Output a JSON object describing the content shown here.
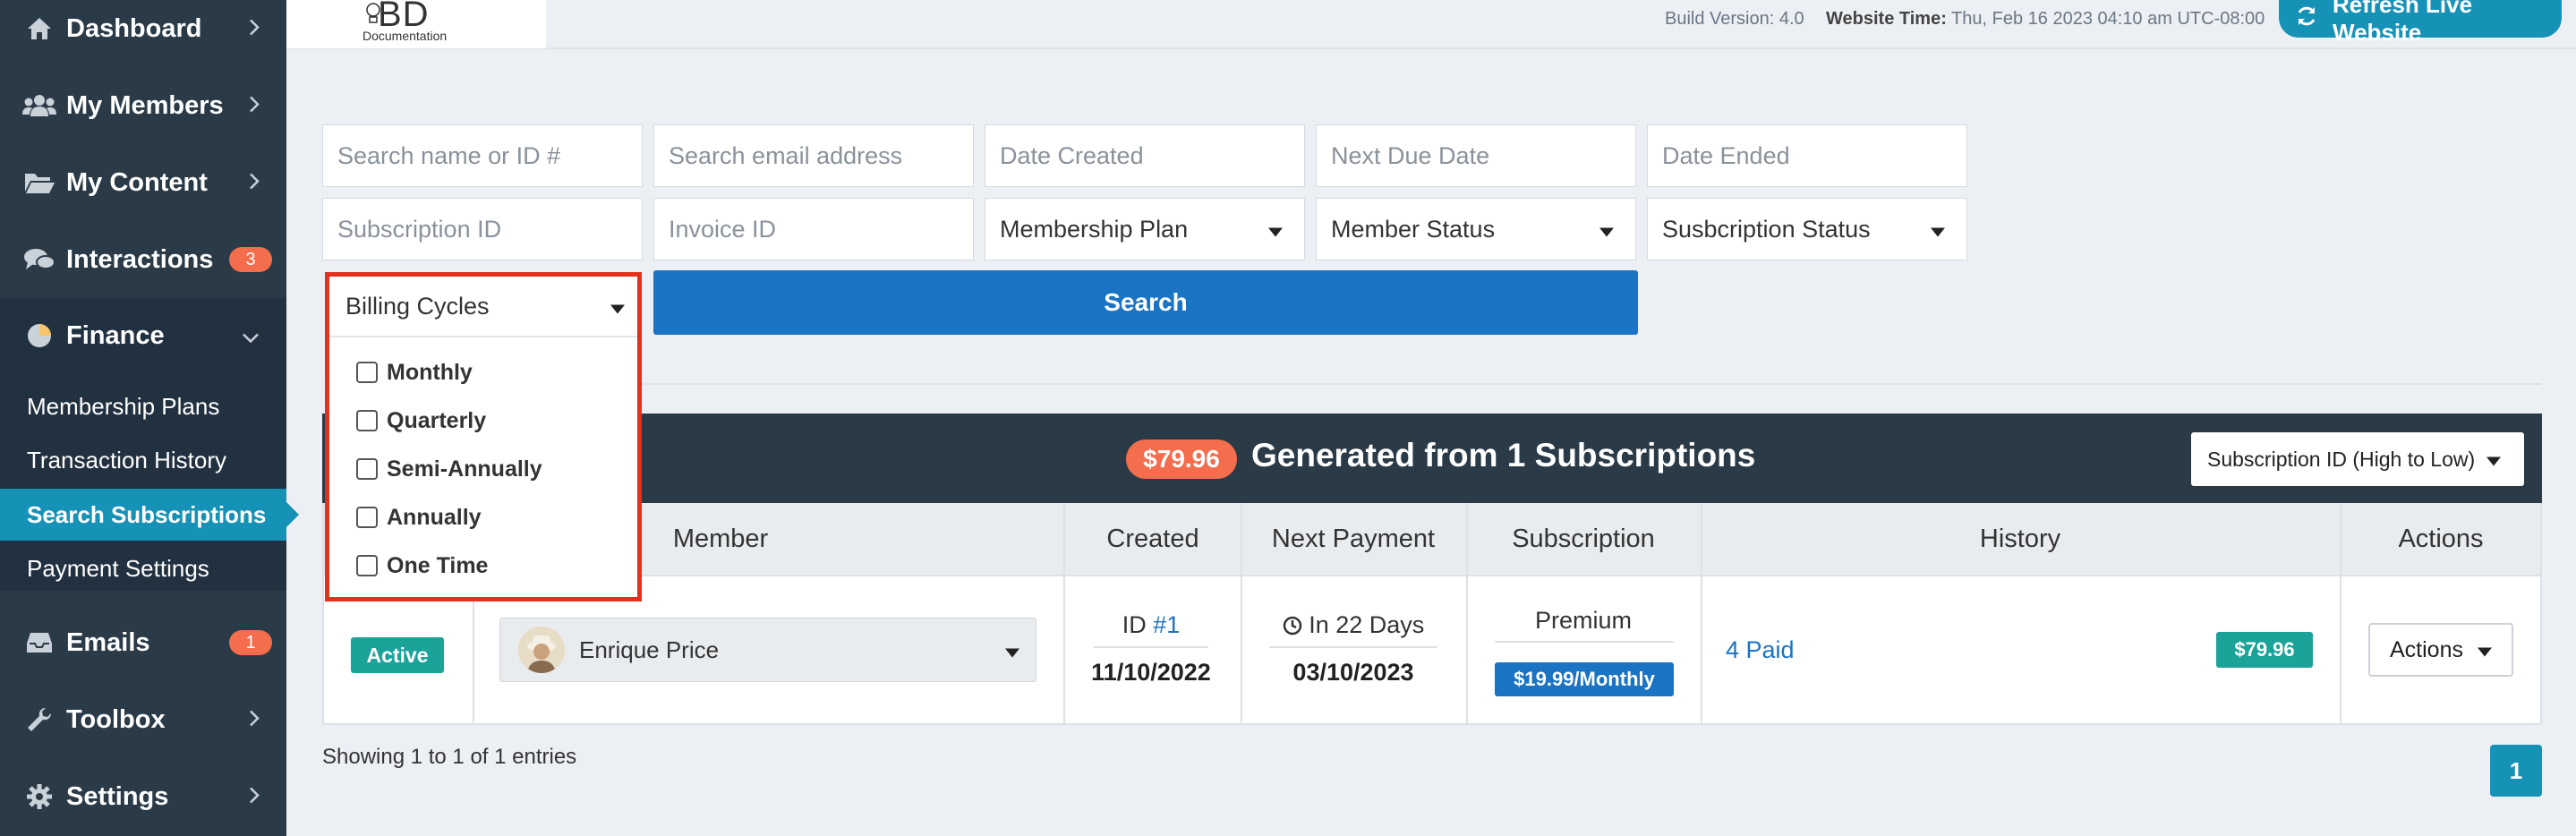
{
  "sidebar": {
    "items": [
      {
        "label": "Dashboard",
        "icon": "home-icon"
      },
      {
        "label": "My Members",
        "icon": "users-icon"
      },
      {
        "label": "My Content",
        "icon": "folder-icon"
      },
      {
        "label": "Interactions",
        "icon": "chat-icon",
        "badge": "3"
      },
      {
        "label": "Finance",
        "icon": "pie-chart-icon"
      },
      {
        "label": "Emails",
        "icon": "inbox-icon",
        "badge": "1"
      },
      {
        "label": "Toolbox",
        "icon": "wrench-icon"
      },
      {
        "label": "Settings",
        "icon": "gear-icon"
      }
    ],
    "finance_sub": [
      "Membership Plans",
      "Transaction History",
      "Search Subscriptions",
      "Payment Settings"
    ],
    "active_sub": "Search Subscriptions"
  },
  "header": {
    "logo_text": "BD",
    "logo_sub": "Documentation",
    "build_version": "Build Version: 4.0",
    "website_time_label": "Website Time:",
    "website_time_value": "Thu, Feb 16 2023 04:10 am UTC-08:00",
    "refresh_label": "Refresh Live Website"
  },
  "filters": {
    "search_name_placeholder": "Search name or ID #",
    "search_email_placeholder": "Search email address",
    "date_created_placeholder": "Date Created",
    "next_due_placeholder": "Next Due Date",
    "date_ended_placeholder": "Date Ended",
    "subscription_id_placeholder": "Subscription ID",
    "invoice_id_placeholder": "Invoice ID",
    "membership_plan": "Membership Plan",
    "member_status": "Member Status",
    "subscription_status": "Susbcription Status",
    "search_label": "Search"
  },
  "billing_dropdown": {
    "label": "Billing Cycles",
    "options": [
      "Monthly",
      "Quarterly",
      "Semi-Annually",
      "Annually",
      "One Time"
    ]
  },
  "results": {
    "amount": "$79.96",
    "generated_text": "Generated from 1 Subscriptions",
    "sort_label": "Subscription ID (High to Low)",
    "columns": [
      "Member",
      "Created",
      "Next Payment",
      "Subscription",
      "History",
      "Actions"
    ],
    "row": {
      "status": "Active",
      "member_name": "Enrique Price",
      "id_label": "ID",
      "id_value": "#1",
      "created_date": "11/10/2022",
      "next_payment_rel": "In 22 Days",
      "next_payment_date": "03/10/2023",
      "plan_name": "Premium",
      "plan_price": "$19.99/Monthly",
      "history_link": "4 Paid",
      "history_amount": "$79.96",
      "actions_label": "Actions"
    },
    "showing_text": "Showing 1 to 1 of 1 entries",
    "page": "1"
  },
  "colors": {
    "sidebar_bg": "#2a3a47",
    "accent_teal": "#1792b7",
    "accent_blue": "#1a74c3",
    "badge_orange": "#f46d4c",
    "highlight_red": "#e2311c",
    "success_green": "#1ba39a"
  }
}
